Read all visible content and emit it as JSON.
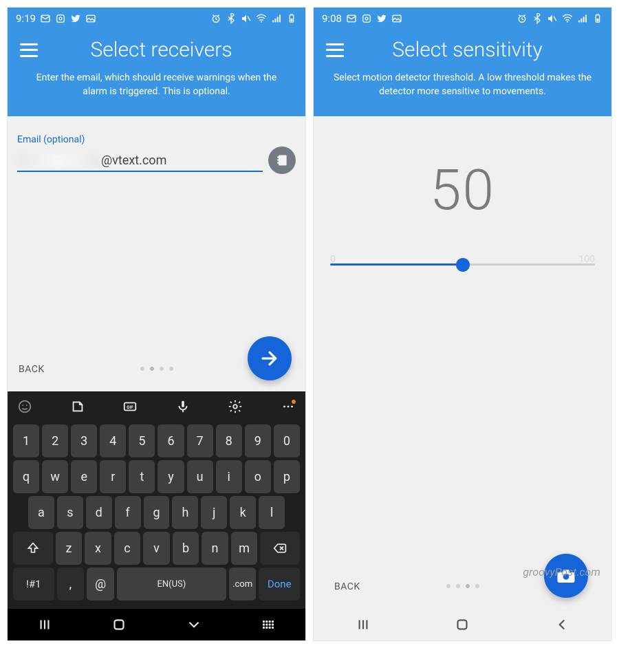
{
  "left": {
    "status_time": "9:19",
    "title": "Select receivers",
    "subtitle": "Enter the email, which should receive warnings when the alarm is triggered. This is optional.",
    "email_label": "Email (optional)",
    "email_value_suffix": "@vtext.com",
    "back_label": "BACK",
    "next_icon": "arrow-right",
    "contact_icon": "address-book"
  },
  "right": {
    "status_time": "9:08",
    "title": "Select sensitivity",
    "subtitle": "Select motion detector threshold. A low threshold makes the detector more sensitive to movements.",
    "value": "50",
    "slider": {
      "min": "0",
      "max": "100",
      "value": "50"
    },
    "back_label": "BACK",
    "fab_icon": "camera"
  },
  "keyboard": {
    "toolbar_icons": [
      "emoji",
      "sticker",
      "gif",
      "mic",
      "gear",
      "more"
    ],
    "row_num": [
      "1",
      "2",
      "3",
      "4",
      "5",
      "6",
      "7",
      "8",
      "9",
      "0"
    ],
    "row_q": [
      "q",
      "w",
      "e",
      "r",
      "t",
      "y",
      "u",
      "i",
      "o",
      "p"
    ],
    "row_a": [
      "a",
      "s",
      "d",
      "f",
      "g",
      "h",
      "j",
      "k",
      "l"
    ],
    "row_z": [
      "z",
      "x",
      "c",
      "v",
      "b",
      "n",
      "m"
    ],
    "shift_icon": "shift",
    "backspace_icon": "backspace",
    "sym_label": "!#1",
    "comma_label": ",",
    "at_label": "@",
    "lang_label": "EN(US)",
    "dotcom_label": ".com",
    "done_label": "Done"
  },
  "nav_icons": [
    "recents",
    "home",
    "down",
    "keyboard-toggle"
  ],
  "brand": "groovyPost.com"
}
